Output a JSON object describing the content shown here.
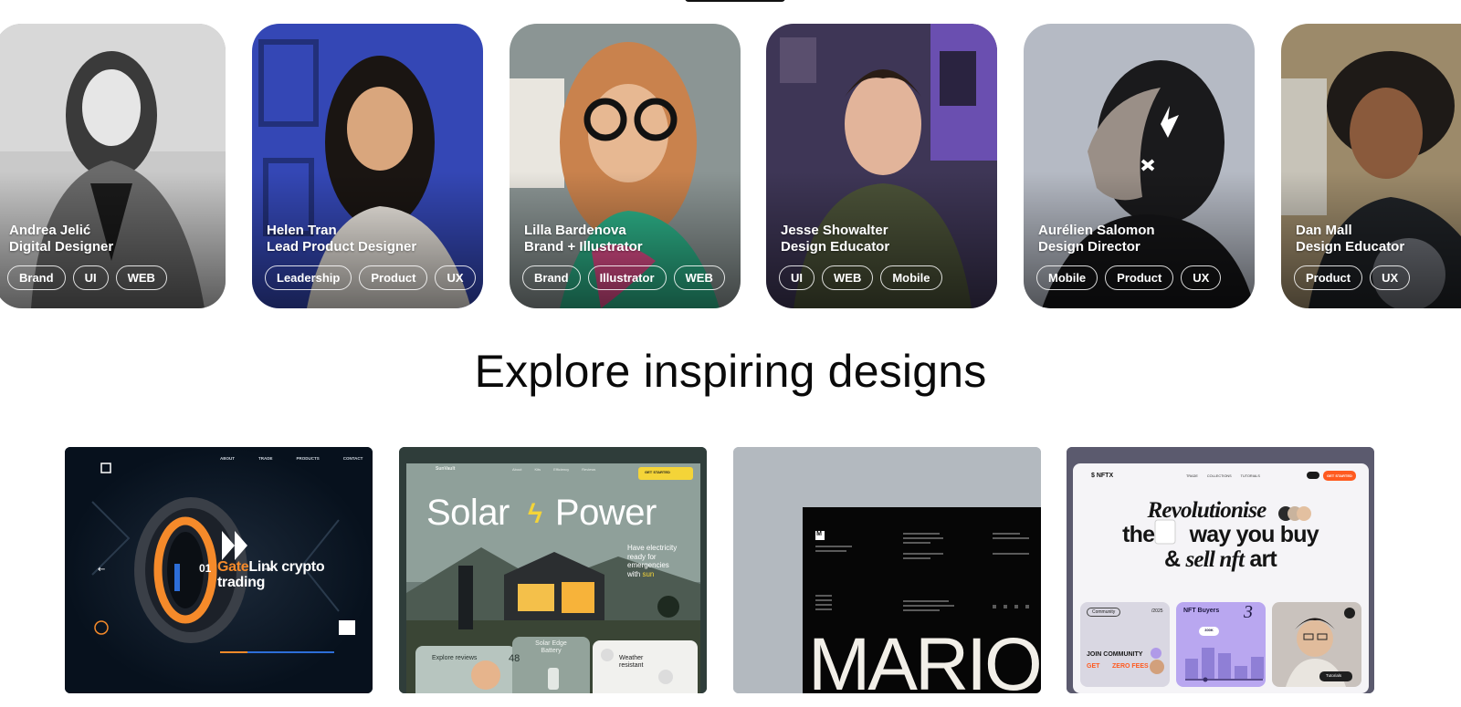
{
  "designers": [
    {
      "name": "Andrea Jelić",
      "role": "Digital Designer",
      "tags": [
        "Brand",
        "UI",
        "WEB"
      ],
      "bg": "#a9a9a9"
    },
    {
      "name": "Helen Tran",
      "role": "Lead Product Designer",
      "tags": [
        "Leadership",
        "Product",
        "UX"
      ],
      "bg": "#3b4fb8"
    },
    {
      "name": "Lilla Bardenova",
      "role": "Brand + Illustrator",
      "tags": [
        "Brand",
        "Illustrator",
        "WEB"
      ],
      "bg": "#7f8f8e"
    },
    {
      "name": "Jesse Showalter",
      "role": "Design Educator",
      "tags": [
        "UI",
        "WEB",
        "Mobile"
      ],
      "bg": "#4a3f63"
    },
    {
      "name": "Aurélien Salomon",
      "role": "Design Director",
      "tags": [
        "Mobile",
        "Product",
        "UX"
      ],
      "bg": "#aab0bb"
    },
    {
      "name": "Dan Mall",
      "role": "Design Educator",
      "tags": [
        "Product",
        "UX"
      ],
      "bg": "#8d7a5a"
    }
  ],
  "section": {
    "title": "Explore inspiring designs"
  },
  "shots": {
    "gatelink": {
      "headline_accent": "Gate",
      "headline_rest": "Link crypto",
      "headline_line2": "trading",
      "counter": "01",
      "nav": [
        "ABOUT",
        "TRADE",
        "PRODUCTS",
        "CONTACT"
      ]
    },
    "solar": {
      "brand": "SunVault",
      "title_left": "Solar",
      "title_right": "Power",
      "cta": "GET STARTED",
      "side_text_1": "Have electricity",
      "side_text_2": "ready for",
      "side_text_3": "emergencies",
      "side_text_4": "with",
      "side_text_brand": "sun",
      "tile_1": "Explore reviews",
      "tile_1_num": "48",
      "tile_2": "Solar Edge Battery",
      "tile_3": "Weather resistant",
      "nav": [
        "About",
        "Kits",
        "Efficiency",
        "Reviews"
      ]
    },
    "mario": {
      "logo": "M",
      "big_text": "MARIO"
    },
    "nftx": {
      "brand": "NFTX",
      "nav": [
        "TRADE",
        "COLLECTIONS",
        "TUTORIALS"
      ],
      "cta": "GET STARTED",
      "line1": "Revolutionise",
      "line2_a": "the",
      "line2_b": "way you buy",
      "line3_a": "&",
      "line3_b": "sell nft",
      "line3_c": "art",
      "community_tag": "Community",
      "community_year": "/2025",
      "join": "JOIN COMMUNITY",
      "get": "GET",
      "zero_fees": "ZERO FEES",
      "buyers": "NFT Buyers",
      "buyers_stat": "3",
      "buyers_badge": "300K",
      "tutorials": "Tutorials"
    }
  },
  "colors": {
    "orange": "#f58a2a",
    "nft_orange": "#ff5a1f",
    "solar_yellow": "#f4d438"
  }
}
